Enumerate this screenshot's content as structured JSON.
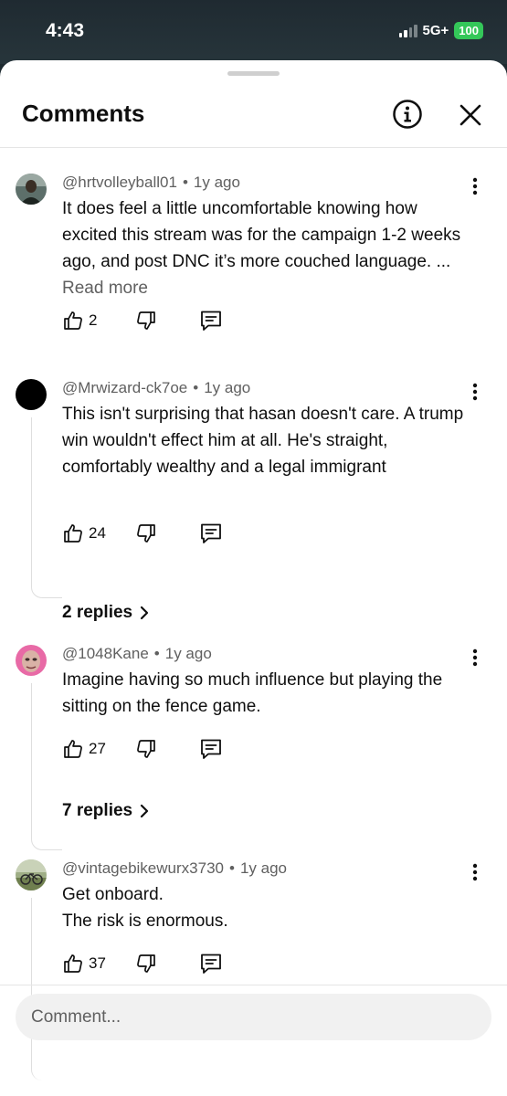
{
  "status": {
    "time": "4:43",
    "network": "5G+",
    "battery": "100"
  },
  "header": {
    "title": "Comments"
  },
  "comments": [
    {
      "author": "@hrtvolleyball01",
      "age": "1y ago",
      "text": "It does feel a little uncomfortable knowing how excited this stream was for the campaign 1-2 weeks ago, and post DNC it’s more couched language. ...",
      "read_more": "Read more",
      "likes": "2"
    },
    {
      "author": "@Mrwizard-ck7oe",
      "age": "1y ago",
      "text": "This isn't surprising that hasan doesn't care. A trump win wouldn't effect him at all. He's straight, comfortably wealthy and a legal immigrant",
      "likes": "24",
      "replies": "2 replies"
    },
    {
      "author": "@1048Kane",
      "age": "1y ago",
      "text": "Imagine having so much influence but playing the sitting on the fence game.",
      "likes": "27",
      "replies": "7 replies"
    },
    {
      "author": "@vintagebikewurx3730",
      "age": "1y ago",
      "text_line1": "Get onboard.",
      "text_line2": "The risk is enormous.",
      "likes": "37"
    }
  ],
  "composer": {
    "placeholder": "Comment..."
  },
  "icons": {
    "info": "info-icon",
    "close": "close-icon",
    "like": "thumbs-up-icon",
    "dislike": "thumbs-down-icon",
    "reply": "reply-icon",
    "more": "more-vertical-icon",
    "chevron": "chevron-right-icon"
  }
}
